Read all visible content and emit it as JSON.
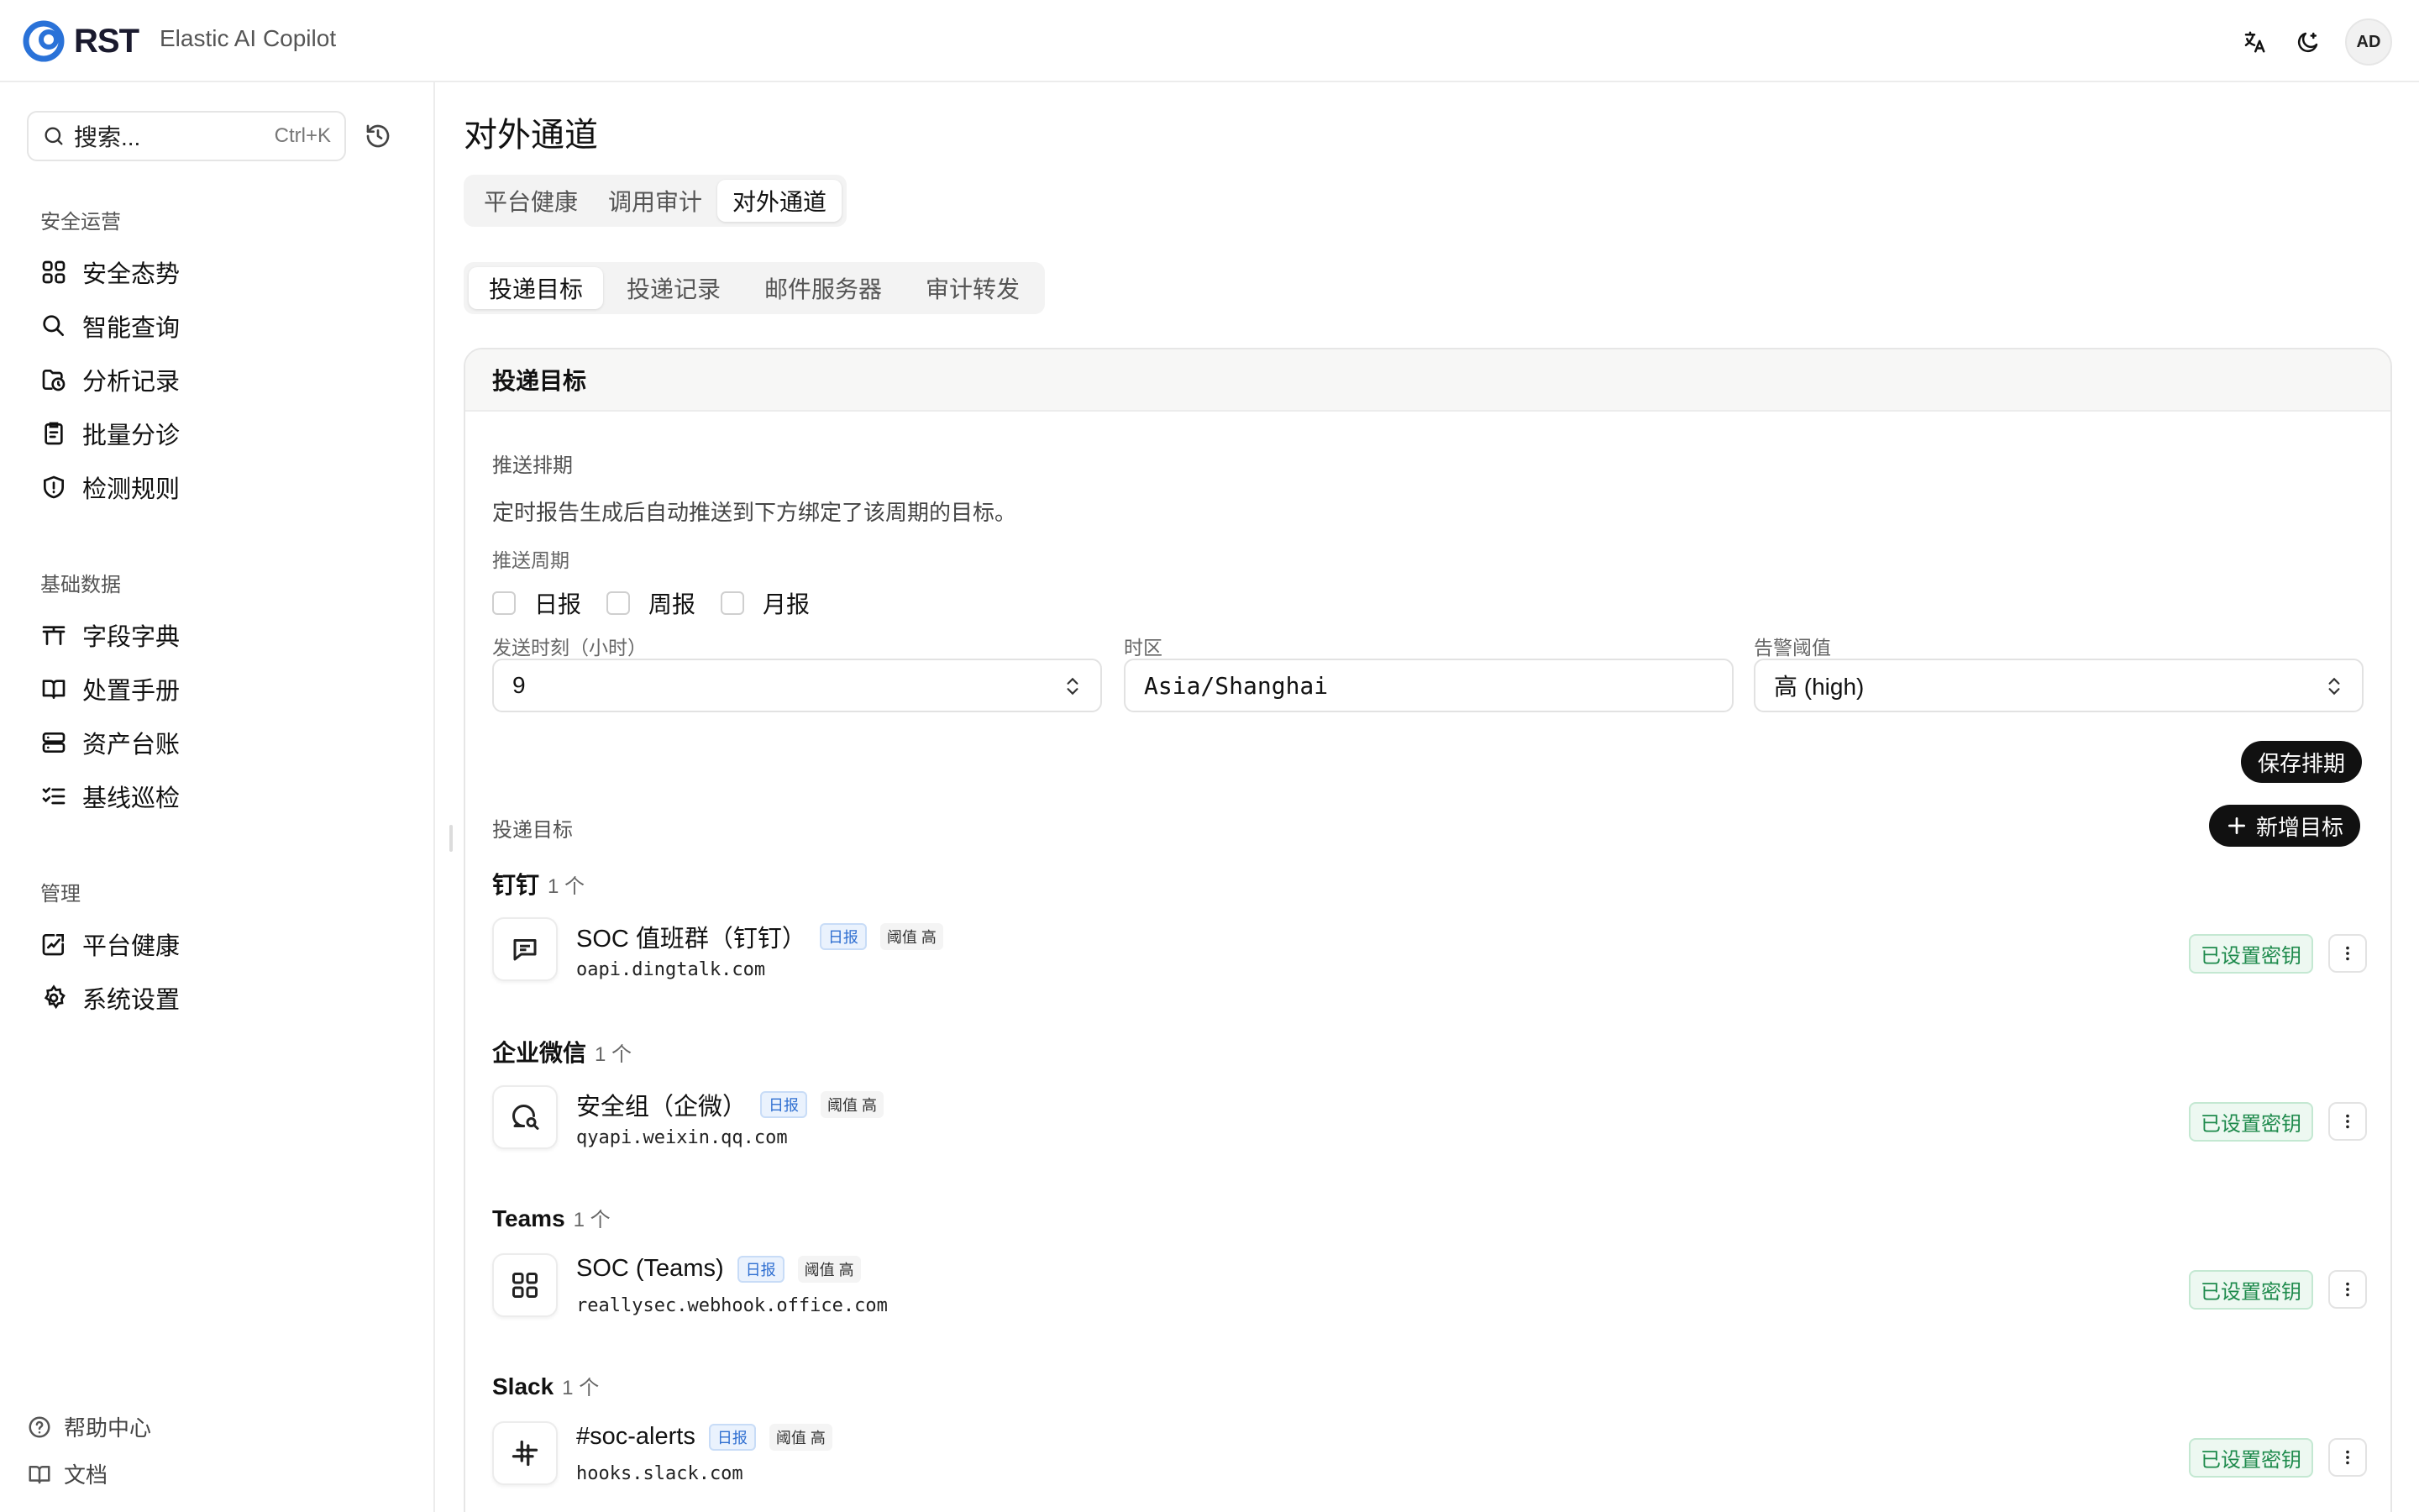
{
  "brand": {
    "logo_text": "RST",
    "app_name": "Elastic AI Copilot"
  },
  "topbar": {
    "avatar": "AD",
    "icons": [
      "translate-icon",
      "theme-toggle-icon"
    ]
  },
  "sidebar": {
    "search_placeholder": "搜索...",
    "search_shortcut": "Ctrl+K",
    "groups": [
      {
        "title": "安全运营",
        "items": [
          "安全态势",
          "智能查询",
          "分析记录",
          "批量分诊",
          "检测规则"
        ]
      },
      {
        "title": "基础数据",
        "items": [
          "字段字典",
          "处置手册",
          "资产台账",
          "基线巡检"
        ]
      },
      {
        "title": "管理",
        "items": [
          "平台健康",
          "系统设置"
        ]
      }
    ],
    "bottom": [
      "帮助中心",
      "文档"
    ]
  },
  "main": {
    "title": "对外通道",
    "tabs": [
      "平台健康",
      "调用审计",
      "对外通道"
    ],
    "active_tab": 2,
    "subtabs": [
      "投递目标",
      "投递记录",
      "邮件服务器",
      "审计转发"
    ],
    "active_subtab": 0
  },
  "card": {
    "header": "投递目标",
    "schedule_label": "推送排期",
    "schedule_desc": "定时报告生成后自动推送到下方绑定了该周期的目标。",
    "period_label": "推送周期",
    "periods": [
      "日报",
      "周报",
      "月报"
    ],
    "hour_label": "发送时刻（小时）",
    "hour_value": "9",
    "tz_label": "时区",
    "tz_value": "Asia/Shanghai",
    "threshold_label": "告警阈值",
    "threshold_value": "高 (high)",
    "save_btn": "保存排期",
    "targets_label": "投递目标",
    "add_btn": "新增目标",
    "groups": [
      {
        "name": "钉钉",
        "count": "1 个",
        "targets": [
          {
            "name": "SOC 值班群（钉钉）",
            "period": "日报",
            "threshold": "阈值 高",
            "host": "oapi.dingtalk.com",
            "status": "已设置密钥"
          }
        ]
      },
      {
        "name": "企业微信",
        "count": "1 个",
        "targets": [
          {
            "name": "安全组（企微）",
            "period": "日报",
            "threshold": "阈值 高",
            "host": "qyapi.weixin.qq.com",
            "status": "已设置密钥"
          }
        ]
      },
      {
        "name": "Teams",
        "count": "1 个",
        "targets": [
          {
            "name": "SOC (Teams)",
            "period": "日报",
            "threshold": "阈值 高",
            "host": "reallysec.webhook.office.com",
            "status": "已设置密钥"
          }
        ]
      },
      {
        "name": "Slack",
        "count": "1 个",
        "targets": [
          {
            "name": "#soc-alerts",
            "period": "日报",
            "threshold": "阈值 高",
            "host": "hooks.slack.com",
            "status": "已设置密钥"
          }
        ]
      }
    ]
  }
}
